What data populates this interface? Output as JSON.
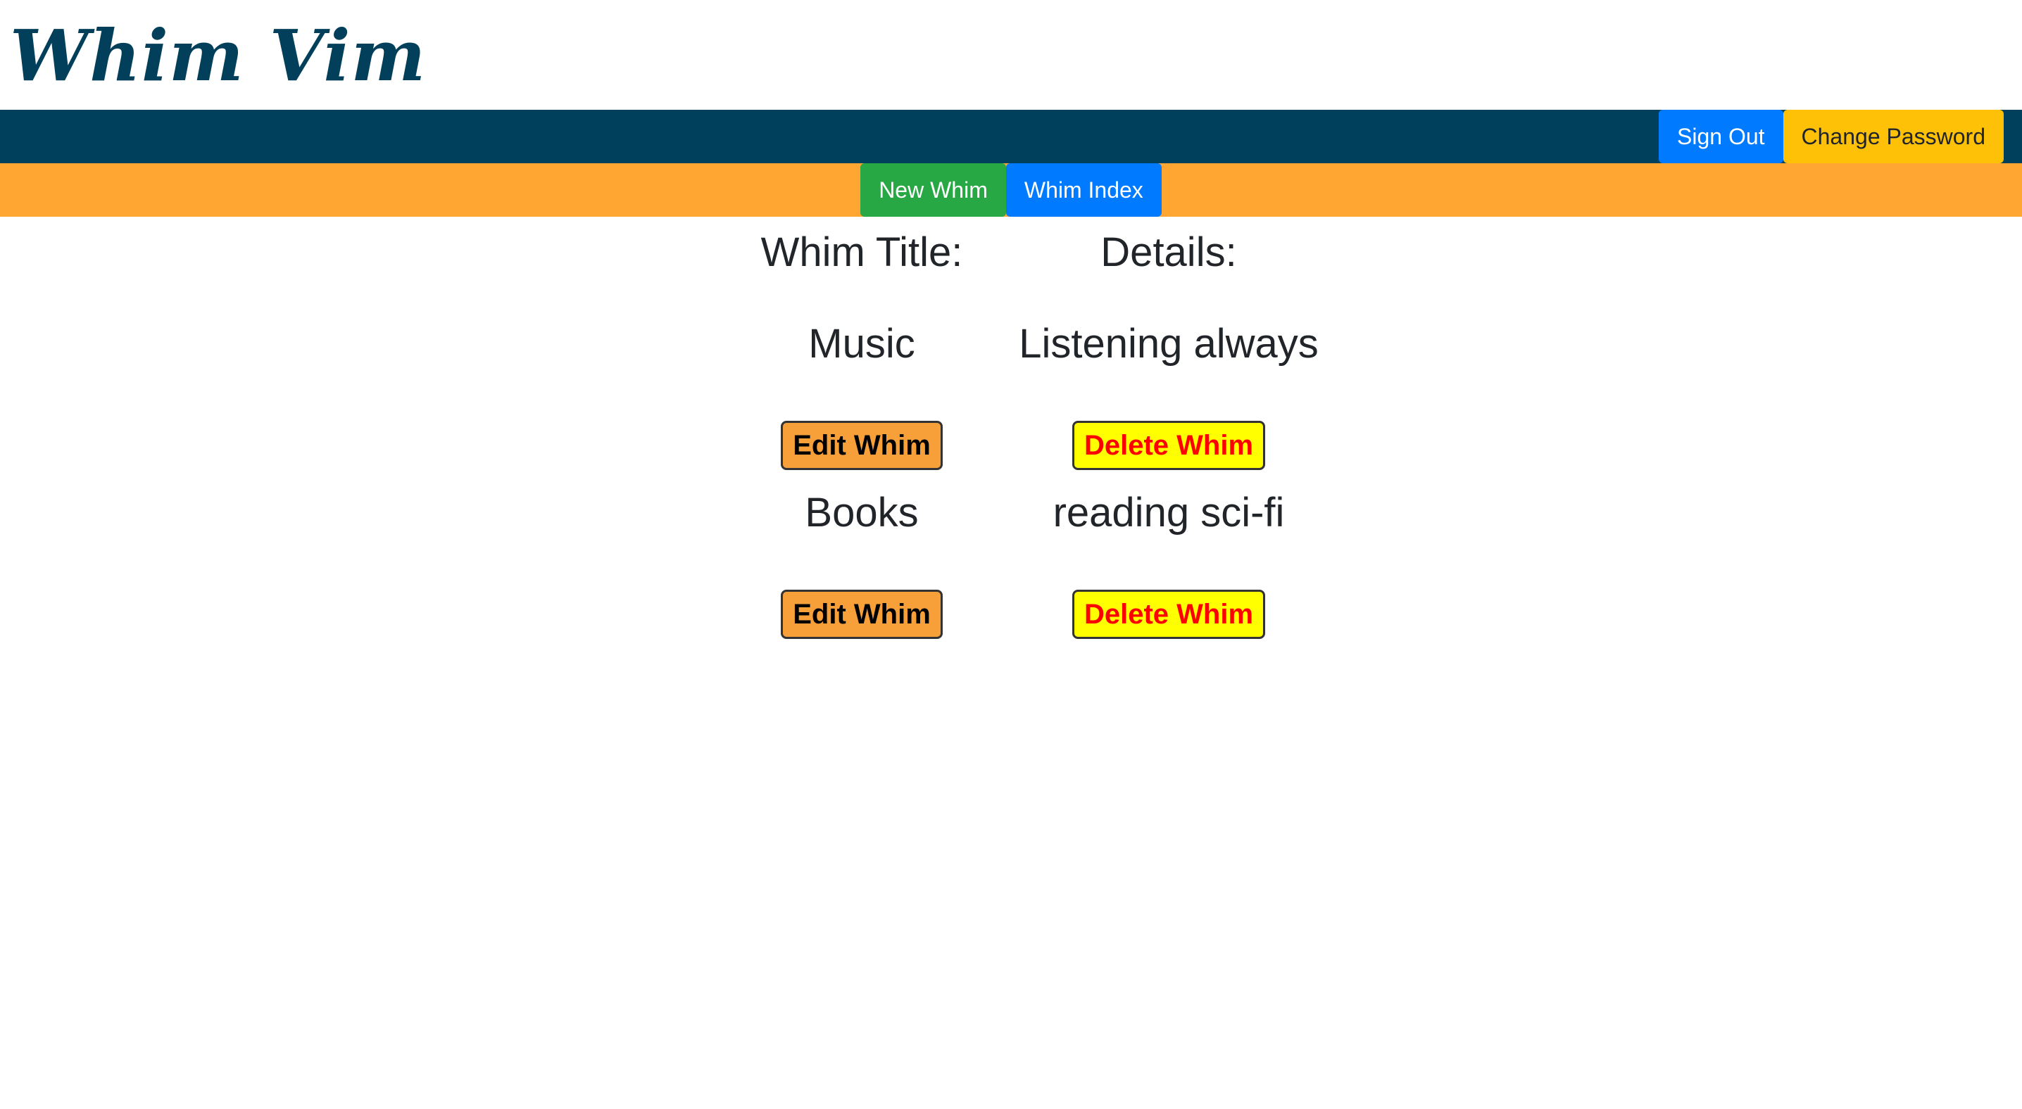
{
  "app": {
    "logo": "Whim Vim"
  },
  "navbar": {
    "sign_out_label": "Sign Out",
    "change_password_label": "Change Password"
  },
  "subnav": {
    "new_whim_label": "New Whim",
    "whim_index_label": "Whim Index"
  },
  "table": {
    "title_header": "Whim Title:",
    "details_header": "Details:",
    "rows": [
      {
        "title": "Music",
        "details": "Listening always",
        "edit_label": "Edit Whim",
        "delete_label": "Delete Whim"
      },
      {
        "title": "Books",
        "details": "reading sci-fi",
        "edit_label": "Edit Whim",
        "delete_label": "Delete Whim"
      }
    ]
  },
  "colors": {
    "navbar": "#00405d",
    "subnav": "#ffa531",
    "logo": "#023f5a",
    "sign_out": "#007bff",
    "change_password": "#ffc107",
    "new_whim": "#28a745",
    "whim_index": "#007bff",
    "edit_button": "#f7a03a",
    "delete_button": "#ffff00",
    "delete_text": "#ff0000"
  }
}
